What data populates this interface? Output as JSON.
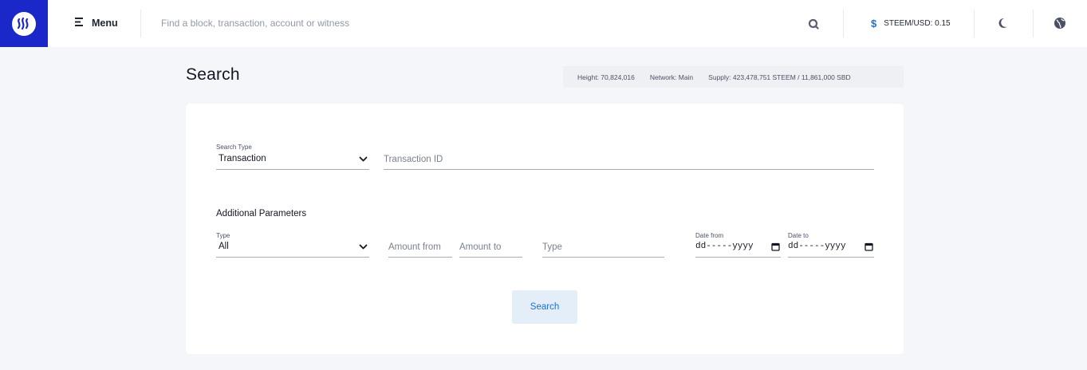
{
  "header": {
    "menu_label": "Menu",
    "search_placeholder": "Find a block, transaction, account or witness",
    "price_symbol": "$",
    "price_label": "STEEM/USD: 0.15",
    "icons": {
      "logo": "steem-logo-icon",
      "menu": "hamburger-icon",
      "search": "search-icon",
      "theme": "moon-icon",
      "language": "globe-icon"
    }
  },
  "page": {
    "title": "Search",
    "stats": {
      "height": "Height: 70,824,016",
      "network": "Network: Main",
      "supply": "Supply: 423,478,751 STEEM / 11,861,000 SBD"
    }
  },
  "form": {
    "search_type_label": "Search Type",
    "search_type_value": "Transaction",
    "transaction_id_placeholder": "Transaction ID",
    "additional_heading": "Additional Parameters",
    "type_label": "Type",
    "type_value": "All",
    "amount_from_placeholder": "Amount from",
    "amount_to_placeholder": "Amount to",
    "type_text_placeholder": "Type",
    "date_from_label": "Date from",
    "date_from_value": "dd-----yyyy",
    "date_to_label": "Date to",
    "date_to_value": "dd-----yyyy",
    "submit_label": "Search"
  },
  "colors": {
    "brand": "#1a28c9",
    "accent": "#1e6fd6",
    "page_bg": "#f5f6f9",
    "button_bg": "#e4eef8"
  }
}
